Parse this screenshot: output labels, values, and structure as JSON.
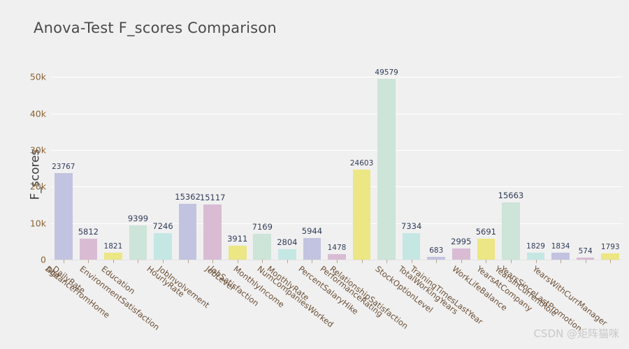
{
  "chart_data": {
    "type": "bar",
    "title": "Anova-Test F_scores Comparison",
    "xlabel": "",
    "ylabel": "F_scores",
    "ylim": [
      0,
      52000
    ],
    "yticks": [
      0,
      10000,
      20000,
      30000,
      40000,
      50000
    ],
    "ytick_labels": [
      "0",
      "10k",
      "20k",
      "30k",
      "40k",
      "50k"
    ],
    "grid": true,
    "legend": "none",
    "categories": [
      "Age",
      "DailyRate",
      "DistanceFromHome",
      "Education",
      "EnvironmentSatisfaction",
      "HourlyRate",
      "JobInvolvement",
      "JobLevel",
      "JobSatisfaction",
      "MonthlyIncome",
      "MonthlyRate",
      "NumCompaniesWorked",
      "PercentSalaryHike",
      "PerformanceRating",
      "RelationshipSatisfaction",
      "StockOptionLevel",
      "TotalWorkingYears",
      "TrainingTimesLastYear",
      "WorkLifeBalance",
      "YearsAtCompany",
      "YearsInCurrentRole",
      "YearsSinceLastPromotion",
      "YearsWithCurrManager"
    ],
    "values": [
      23767,
      5812,
      1821,
      9399,
      7246,
      15362,
      15117,
      3911,
      7169,
      2804,
      5944,
      1478,
      24603,
      49579,
      7334,
      683,
      2995,
      5691,
      15663,
      1829,
      1834,
      574,
      1793
    ],
    "value_labels": [
      "23767",
      "5812",
      "1821",
      "9399",
      "7246",
      "15362",
      "15117",
      "3911",
      "7169",
      "2804",
      "5944",
      "1478",
      "24603",
      "49579",
      "7334",
      "683",
      "2995",
      "5691",
      "15663",
      "1829",
      "1834",
      "574",
      "1793"
    ],
    "bar_colors": [
      "#c2c3e0",
      "#d9bcd4",
      "#ece684",
      "#cde4d8",
      "#c4e7e4",
      "#c2c3e0",
      "#d9bcd4",
      "#ece684",
      "#cde4d8",
      "#c4e7e4",
      "#c2c3e0",
      "#d9bcd4",
      "#ece684",
      "#cde4d8",
      "#c4e7e4",
      "#c2c3e0",
      "#d9bcd4",
      "#ece684",
      "#cde4d8",
      "#c4e7e4",
      "#c2c3e0",
      "#d9bcd4",
      "#ece684"
    ],
    "palette": [
      "#c2c3e0",
      "#d9bcd4",
      "#ece684",
      "#cde4d8",
      "#c4e7e4"
    ]
  },
  "style": {
    "background": "#f0f0f0",
    "title_color": "#4a4a4a",
    "axis_title_color": "#3d3d3d",
    "ytick_color": "#8a6233",
    "xtick_color": "#6b4f35",
    "value_label_color": "#2f3b57",
    "gridline_color": "#ffffff"
  },
  "watermark": {
    "text": "CSDN @矩阵猫咪"
  }
}
